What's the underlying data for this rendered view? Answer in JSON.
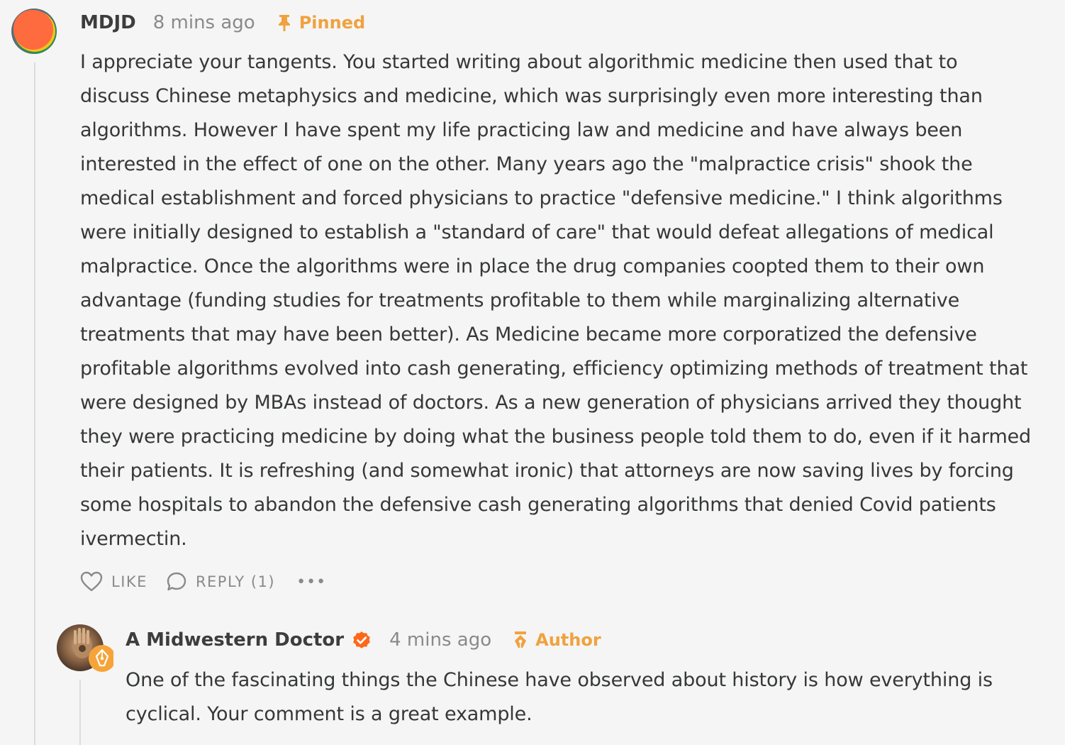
{
  "comment": {
    "author": "MDJD",
    "time": "8 mins ago",
    "badge_label": "Pinned",
    "body": "I appreciate your tangents. You started writing about algorithmic medicine then used that to\ndiscuss Chinese metaphysics and medicine, which was surprisingly even more interesting than\nalgorithms. However I have spent my life practicing law and medicine and have always been\ninterested in the effect of one on the other. Many years ago the \"malpractice crisis\" shook the\nmedical establishment and forced physicians to practice \"defensive medicine.\" I think algorithms\nwere initially designed to establish a \"standard of care\" that would defeat allegations of medical\nmalpractice. Once the algorithms were in place the drug companies coopted them to their own\nadvantage (funding studies for treatments profitable to them while marginalizing alternative\ntreatments that may have been better). As Medicine became more corporatized the defensive\nprofitable algorithms evolved into cash generating, efficiency optimizing methods of treatment that\nwere designed by MBAs instead of doctors. As a new generation of physicians arrived they thought\nthey were practicing medicine by doing what the business people told them to do, even if it harmed\ntheir patients. It is refreshing (and somewhat ironic) that attorneys are now saving lives by forcing\nsome hospitals to abandon the defensive cash generating algorithms that denied Covid patients\nivermectin.",
    "actions": {
      "like_label": "LIKE",
      "reply_label": "REPLY (1)",
      "more_label": "•••"
    }
  },
  "reply": {
    "author": "A Midwestern Doctor",
    "time": "4 mins ago",
    "badge_label": "Author",
    "body": "One of the fascinating things the Chinese have observed about history is how everything is cyclical. Your comment is a great example."
  },
  "colors": {
    "accent": "#f0a23e",
    "verified": "#ff6719",
    "muted": "#8a8a8a",
    "text": "#363737",
    "background": "#f5f5f5"
  },
  "icons": {
    "pinned": "pin-icon",
    "author": "pen-nib-icon",
    "like": "heart-icon",
    "reply": "speech-bubble-icon",
    "more": "ellipsis-icon",
    "verified": "checkmark-badge-icon"
  }
}
